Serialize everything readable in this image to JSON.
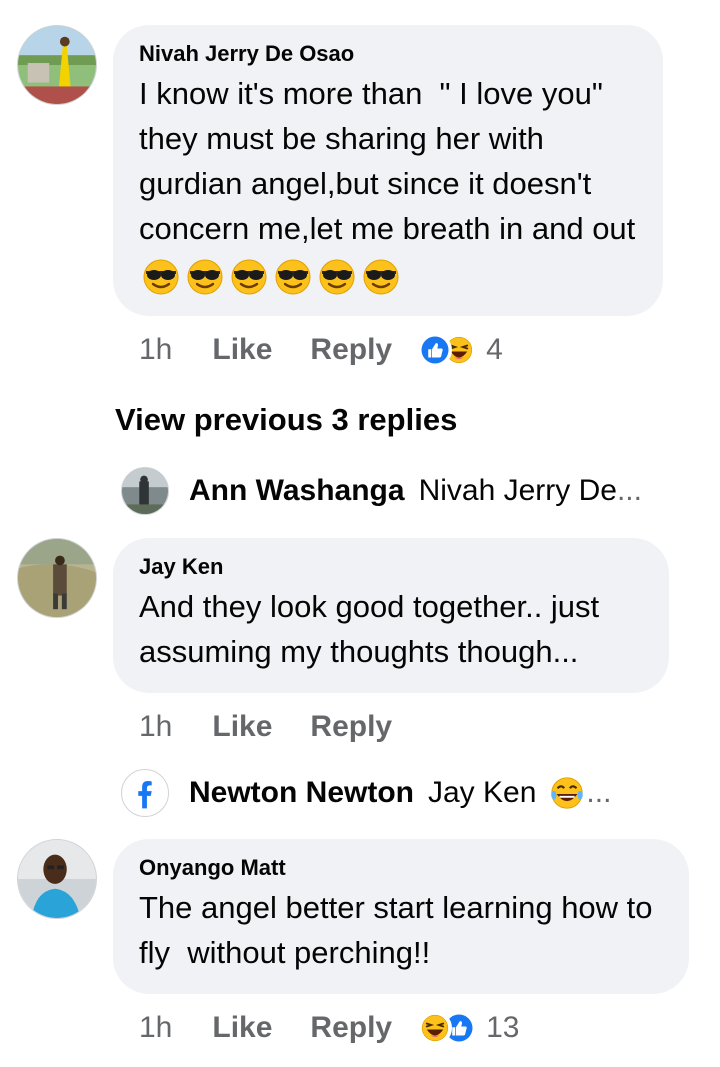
{
  "comments": [
    {
      "author": "Nivah Jerry De Osao",
      "text": "I know it's more than  \" I love you\" they must be sharing her with gurdian angel,but since it doesn't concern me,let me breath in and out",
      "emoji_icon": "sunglasses-emoji",
      "emoji_count": 6,
      "time": "1h",
      "like_label": "Like",
      "reply_label": "Reply",
      "reactions": [
        "like-icon",
        "laughing-emoji"
      ],
      "reaction_count": "4"
    },
    {
      "author": "Jay Ken",
      "text": "And they look good together.. just assuming my thoughts though...",
      "time": "1h",
      "like_label": "Like",
      "reply_label": "Reply"
    },
    {
      "author": "Onyango Matt",
      "text": "The angel better start learning how to fly  without perching!!",
      "time": "1h",
      "like_label": "Like",
      "reply_label": "Reply",
      "reactions": [
        "laughing-emoji",
        "like-icon"
      ],
      "reaction_count": "13"
    }
  ],
  "view_previous": "View previous 3 replies",
  "reply_previews": [
    {
      "name": "Ann Washanga",
      "text": "Nivah Jerry De",
      "ellipsis": "..."
    },
    {
      "name": "Newton Newton",
      "text": "Jay Ken",
      "emoji": "tears-of-joy-emoji",
      "ellipsis": "..."
    }
  ],
  "colors": {
    "bubble": "#f0f2f5",
    "muted": "#65676b",
    "like_blue": "#1877f2",
    "emoji_yellow": "#fcc21b"
  }
}
